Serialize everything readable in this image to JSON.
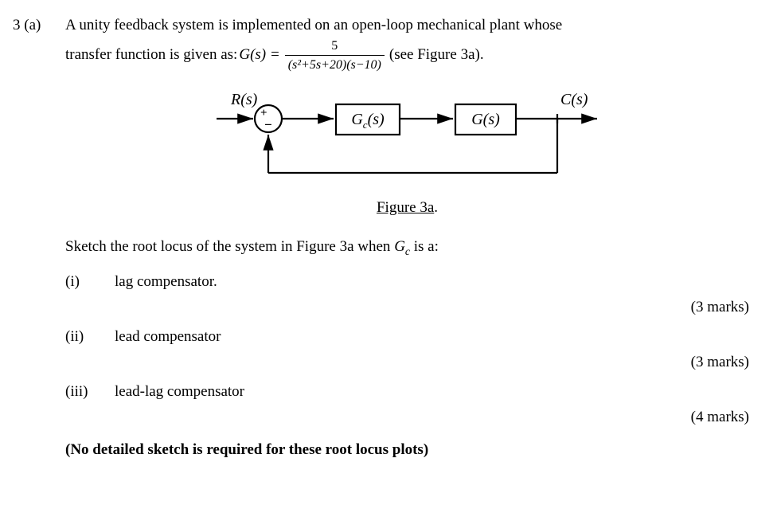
{
  "question_number": "3 (a)",
  "para_line1": "A unity feedback system is implemented on an open-loop mechanical plant whose",
  "para_line2_prefix": "transfer function is given as: ",
  "tf_lhs": "G(s) =",
  "tf_num": "5",
  "tf_den": "(s²+5s+20)(s−10)",
  "para_line2_suffix": " (see Figure 3a).",
  "fig_labels": {
    "R": "R(s)",
    "Gc": "G",
    "Gc_sub": "c",
    "Gc_arg": "(s)",
    "G": "G(s)",
    "C": "C(s)",
    "plus": "+",
    "minus": "−"
  },
  "figure_caption": "Figure 3a",
  "sketch_intro_prefix": "Sketch the root locus of the system in Figure 3a when ",
  "sketch_intro_gc": "G",
  "sketch_intro_gc_sub": "c",
  "sketch_intro_suffix": " is a:",
  "items": [
    {
      "label": "(i)",
      "text": "lag compensator.",
      "marks": "(3 marks)"
    },
    {
      "label": "(ii)",
      "text": "lead compensator",
      "marks": "(3 marks)"
    },
    {
      "label": "(iii)",
      "text": "lead-lag compensator",
      "marks": "(4 marks)"
    }
  ],
  "note": "(No detailed sketch is required for these root locus plots)"
}
